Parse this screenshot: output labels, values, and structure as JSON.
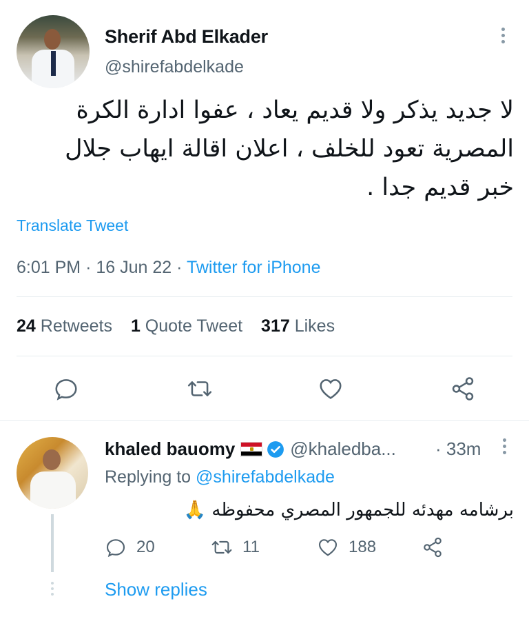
{
  "main_tweet": {
    "author_name": "Sherif Abd Elkader",
    "author_handle": "@shirefabdelkade",
    "text_lines": [
      "لا جديد يذكر ولا قديم يعاد ، عفوا ادارة الكرة",
      "المصرية تعود للخلف ، اعلان اقالة ايهاب جلال",
      "خبر قديم جدا ."
    ],
    "translate_label": "Translate Tweet",
    "time": "6:01 PM",
    "date": "16 Jun 22",
    "source": "Twitter for iPhone",
    "sep": "·",
    "stats": {
      "retweets_count": "24",
      "retweets_label": "Retweets",
      "quotes_count": "1",
      "quotes_label": "Quote Tweet",
      "likes_count": "317",
      "likes_label": "Likes"
    },
    "actions": [
      "reply-icon",
      "retweet-icon",
      "like-icon",
      "share-icon"
    ]
  },
  "reply": {
    "author_name": "khaled bauomy",
    "flag_emoji": "egypt-flag",
    "author_handle": "@khaledba...",
    "time": "· 33m",
    "replying_prefix": "Replying to",
    "replying_to": "@shirefabdelkade",
    "text": "برشامه مهدئه للجمهور المصري محفوظه 🙏",
    "reply_count": "20",
    "retweet_count": "11",
    "like_count": "188"
  },
  "show_replies_label": "Show replies",
  "colors": {
    "link": "#1d9bf0",
    "secondary_text": "#536471",
    "primary_text": "#0f1419",
    "divider": "#e6ecf0"
  }
}
